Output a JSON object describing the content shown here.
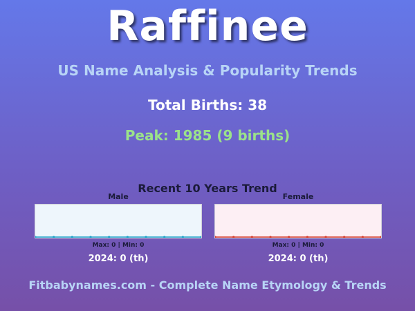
{
  "header": {
    "name": "Raffinee",
    "subtitle": "US Name Analysis & Popularity Trends"
  },
  "summary": {
    "total_births": "Total Births: 38",
    "peak": "Peak: 1985 (9 births)"
  },
  "trend": {
    "title": "Recent 10 Years Trend",
    "male": {
      "label": "Male",
      "stats": "Max: 0 | Min: 0",
      "year_rank": "2024: 0 (th)",
      "line_color": "#1aa0c8",
      "background": "#eef6fc"
    },
    "female": {
      "label": "Female",
      "stats": "Max: 0 | Min: 0",
      "year_rank": "2024: 0 (th)",
      "line_color": "#d43a2a",
      "background": "#fdeff4"
    }
  },
  "chart_data": [
    {
      "type": "line",
      "title": "Male",
      "series": [
        {
          "name": "Male",
          "values": [
            0,
            0,
            0,
            0,
            0,
            0,
            0,
            0,
            0,
            0
          ]
        }
      ]
    },
    {
      "type": "line",
      "title": "Female",
      "series": [
        {
          "name": "Female",
          "values": [
            0,
            0,
            0,
            0,
            0,
            0,
            0,
            0,
            0,
            0
          ]
        }
      ]
    }
  ],
  "footer": {
    "text": "Fitbabynames.com - Complete Name Etymology & Trends"
  }
}
